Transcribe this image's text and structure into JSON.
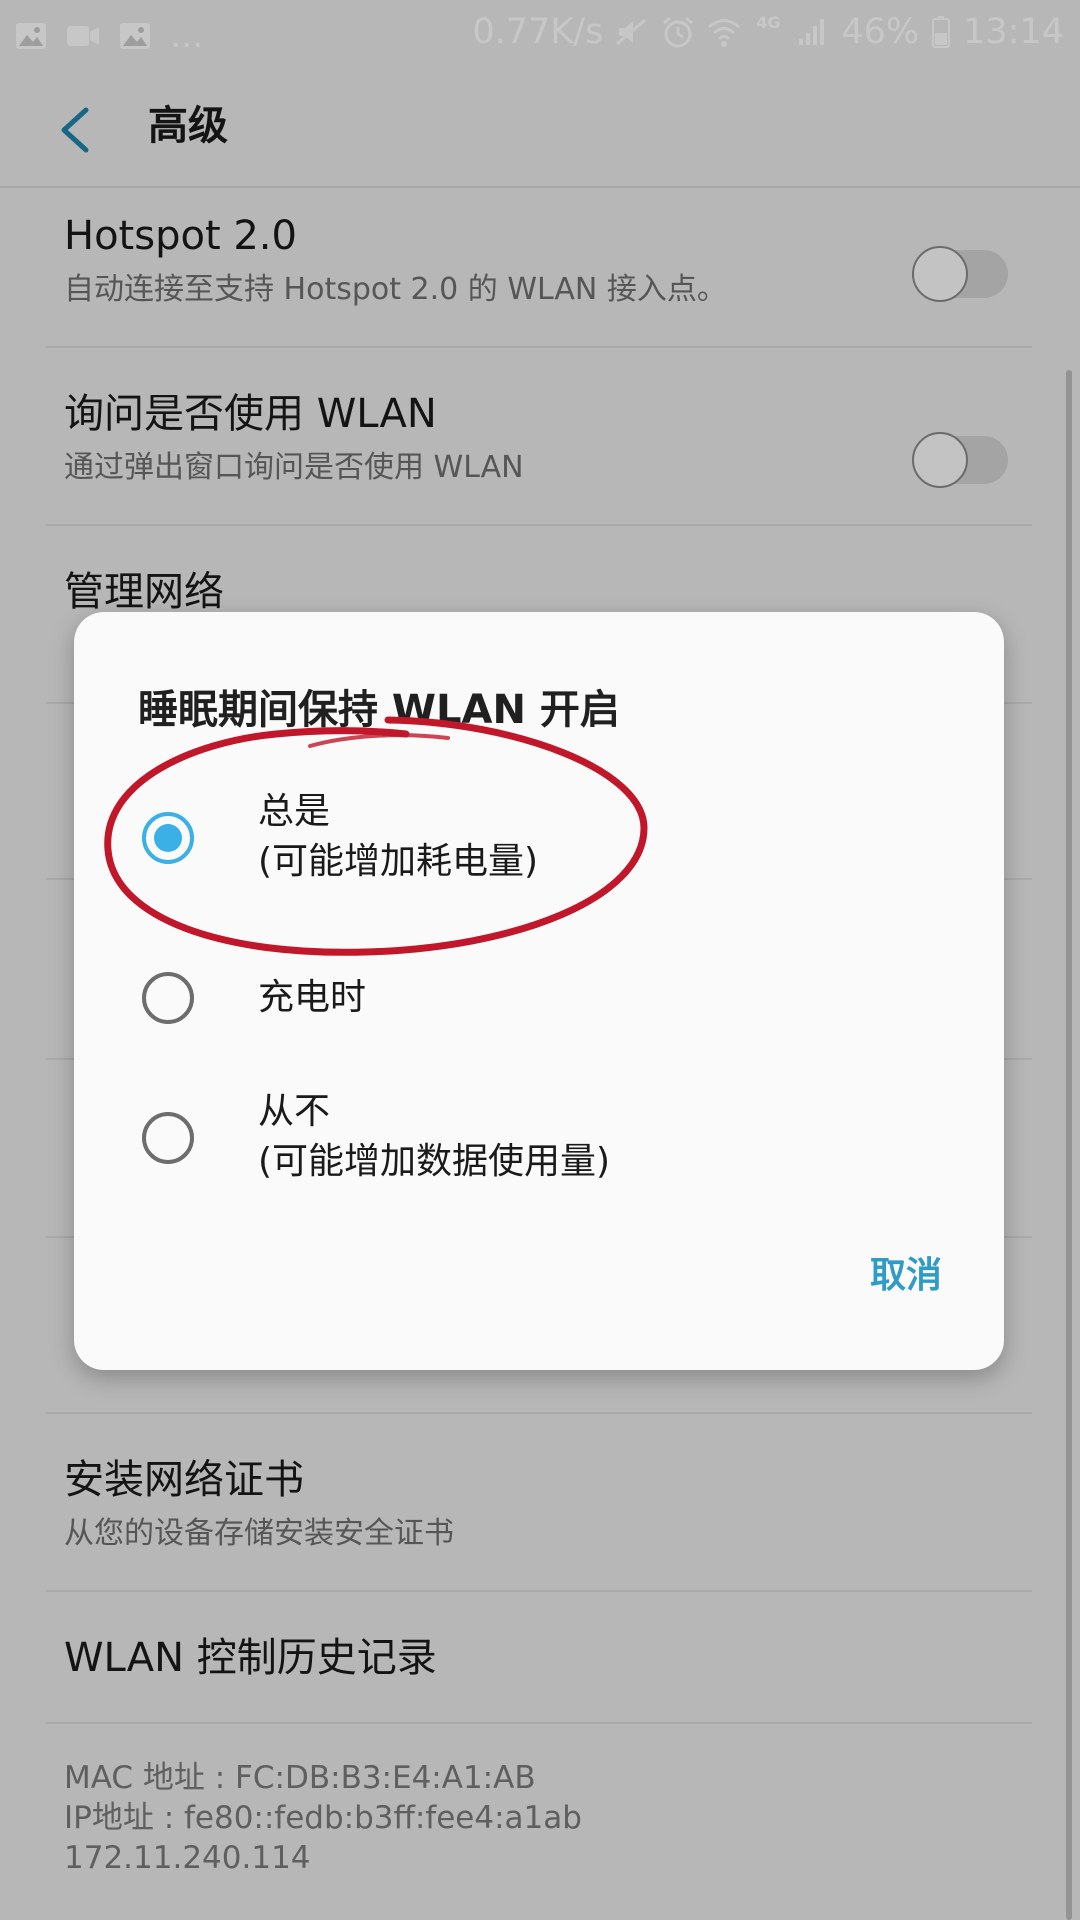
{
  "colors": {
    "accent": "#3bb0e6",
    "cancel": "#2f9bc7",
    "annotation_red": "#c0182a"
  },
  "status_bar": {
    "left_icons": [
      "image-icon",
      "video-icon",
      "image-icon"
    ],
    "more": "...",
    "network_speed": "0.77K/s",
    "right_icons": [
      "mute-icon",
      "alarm-icon",
      "wifi-icon",
      "4g-icon",
      "signal-icon"
    ],
    "network_type": "4G",
    "battery": "46%",
    "time": "13:14"
  },
  "header": {
    "title": "高级",
    "back_icon": "back-arrow-icon"
  },
  "settings": {
    "hotspot": {
      "title": "Hotspot 2.0",
      "subtitle": "自动连接至支持 Hotspot 2.0 的 WLAN 接入点。",
      "enabled": false
    },
    "ask_wlan": {
      "title": "询问是否使用 WLAN",
      "subtitle": "通过弹出窗口询问是否使用 WLAN",
      "enabled": false
    },
    "manage_networks": {
      "title": "管理网络"
    },
    "install_cert": {
      "title": "安装网络证书",
      "subtitle": "从您的设备存储安装安全证书"
    },
    "wlan_history": {
      "title": "WLAN 控制历史记录"
    }
  },
  "device_info": {
    "mac": "MAC 地址 : FC:DB:B3:E4:A1:AB",
    "ip": "IP地址 : fe80::fedb:b3ff:fee4:a1ab",
    "ipv4": "172.11.240.114"
  },
  "dialog": {
    "title": "睡眠期间保持 WLAN 开启",
    "options": [
      {
        "line1": "总是",
        "line2": "(可能增加耗电量)",
        "selected": true
      },
      {
        "line1": "充电时",
        "line2": "",
        "selected": false
      },
      {
        "line1": "从不",
        "line2": "(可能增加数据使用量)",
        "selected": false
      }
    ],
    "cancel": "取消"
  }
}
